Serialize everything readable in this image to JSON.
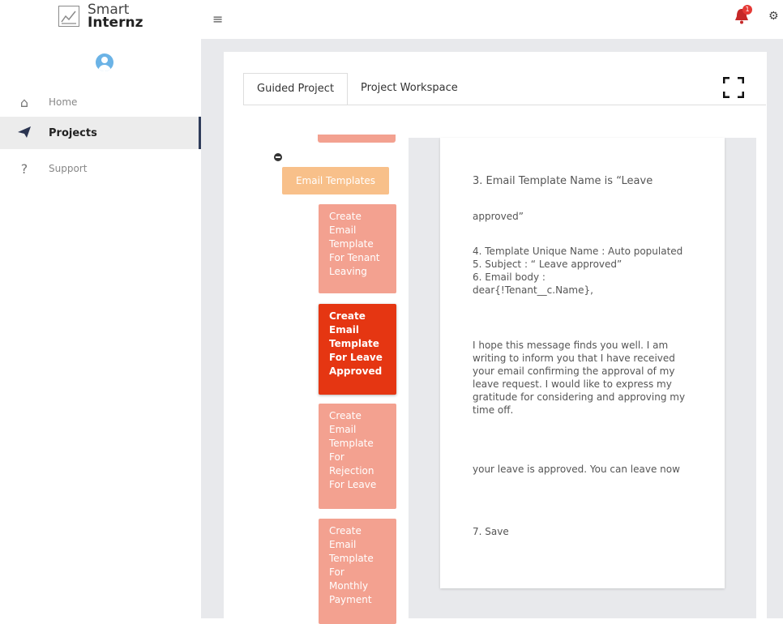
{
  "brand": {
    "line1": "Smart",
    "line2": "Internz"
  },
  "sidebar": {
    "items": [
      {
        "label": "Home",
        "icon": "home-icon"
      },
      {
        "label": "Projects",
        "icon": "paper-plane-icon"
      },
      {
        "label": "Support",
        "icon": "question-icon"
      }
    ]
  },
  "topbar": {
    "notification_count": "1"
  },
  "tabs": [
    {
      "label": "Guided Project"
    },
    {
      "label": "Project Workspace"
    }
  ],
  "tree": {
    "parent": "Email Templates",
    "steps": [
      {
        "label": "Create Email Template For Tenant Leaving"
      },
      {
        "label": "Create Email Template For Leave Approved",
        "active": true
      },
      {
        "label": "Create Email Template For Rejection For Leave"
      },
      {
        "label": "Create Email Template For Monthly Payment"
      }
    ]
  },
  "doc": {
    "line1": "3.  Email Template Name is “Leave",
    "line2": "approved”",
    "line3": "4. Template Unique Name : Auto populated\n5.  Subject : “ Leave approved”\n6. Email body :\ndear{!Tenant__c.Name},",
    "line4": "I hope this message finds you well. I am writing to inform you that I have received your email confirming the approval of my leave request. I would like to express my gratitude for considering and approving my time off.",
    "line5": "your leave is approved. You can leave now",
    "line6": "7. Save"
  },
  "colors": {
    "accent_active": "#e53612",
    "step_bg": "#f3a190",
    "parent_bg": "#f8c08a",
    "nav_active_border": "#2f3c5a"
  }
}
